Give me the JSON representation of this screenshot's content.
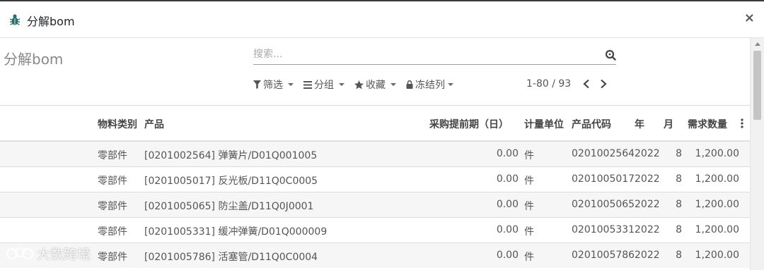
{
  "modal": {
    "title": "分解bom",
    "close_label": "×",
    "icon": "bug-icon"
  },
  "control_panel": {
    "breadcrumb": "分解bom",
    "search_placeholder": "搜索...",
    "filters": [
      {
        "label": "筛选",
        "icon": "filter-icon"
      },
      {
        "label": "分组",
        "icon": "bars-icon"
      },
      {
        "label": "收藏",
        "icon": "star-icon"
      },
      {
        "label": "冻结列",
        "icon": "lock-icon"
      }
    ],
    "pager_text": "1-80 / 93"
  },
  "table": {
    "columns": [
      "物料类别",
      "产品",
      "采购提前期（日）",
      "计量单位",
      "产品代码",
      "年",
      "月",
      "需求数量"
    ],
    "rows": [
      {
        "category": "零部件",
        "product": "[0201002564] 弹簧片/D01Q001005",
        "lead_time": "0.00",
        "uom": "件",
        "code": "0201002564",
        "year": "2022",
        "month": "8",
        "qty": "1,200.00"
      },
      {
        "category": "零部件",
        "product": "[0201005017] 反光板/D11Q0C0005",
        "lead_time": "0.00",
        "uom": "件",
        "code": "0201005017",
        "year": "2022",
        "month": "8",
        "qty": "1,200.00"
      },
      {
        "category": "零部件",
        "product": "[0201005065] 防尘盖/D11Q0J0001",
        "lead_time": "0.00",
        "uom": "件",
        "code": "0201005065",
        "year": "2022",
        "month": "8",
        "qty": "1,200.00"
      },
      {
        "category": "零部件",
        "product": "[0201005331] 缓冲弹簧/D01Q000009",
        "lead_time": "0.00",
        "uom": "件",
        "code": "0201005331",
        "year": "2022",
        "month": "8",
        "qty": "1,200.00"
      },
      {
        "category": "零部件",
        "product": "[0201005786] 活塞管/D11Q0C0004",
        "lead_time": "0.00",
        "uom": "件",
        "code": "0201005786",
        "year": "2022",
        "month": "8",
        "qty": "1,200.00"
      }
    ]
  },
  "watermark": {
    "text": "大数跨境"
  },
  "colors": {
    "accent": "#00a09d",
    "row_alt": "#f6f6f6",
    "border": "#dddddd"
  }
}
